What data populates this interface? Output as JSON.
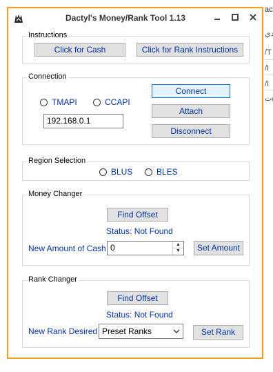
{
  "background": {
    "fragments": [
      "act",
      "دي",
      "/T",
      "/I",
      "/ا",
      "ت/"
    ]
  },
  "window": {
    "title": "Dactyl's Money/Rank Tool 1.13",
    "accent": "#f0a11b",
    "controls": {
      "minimize": "🗕",
      "maximize": "🗖",
      "close": "✕"
    }
  },
  "instructions": {
    "legend": "Instructions",
    "cash_button": "Click for Cash",
    "rank_button": "Click for Rank Instructions"
  },
  "connection": {
    "legend": "Connection",
    "radio_tmapi": "TMAPI",
    "radio_ccapi": "CCAPI",
    "ip_value": "192.168.0.1",
    "connect_button": "Connect",
    "attach_button": "Attach",
    "disconnect_button": "Disconnect"
  },
  "region": {
    "legend": "Region Selection",
    "radio_blus": "BLUS",
    "radio_bles": "BLES"
  },
  "money": {
    "legend": "Money Changer",
    "find_button": "Find  Offset",
    "status": "Status:  Not Found",
    "amount_label": "New Amount of Cash",
    "amount_value": "0",
    "set_button": "Set Amount"
  },
  "rank": {
    "legend": "Rank Changer",
    "find_button": "Find  Offset",
    "status": "Status:  Not Found",
    "rank_label": "New Rank Desired",
    "rank_select": "Preset Ranks",
    "set_button": "Set Rank"
  }
}
